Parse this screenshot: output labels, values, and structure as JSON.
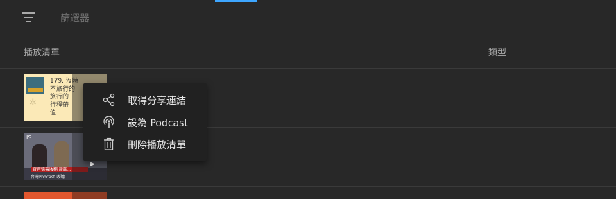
{
  "filter": {
    "icon": "filter-icon",
    "label": "篩選器"
  },
  "table": {
    "headers": {
      "playlist": "播放清單",
      "type": "類型"
    },
    "rows": [
      {
        "thumbnail_text": "179. 沒時\n不旅行的\n旅行的\n行程帶\n值"
      },
      {
        "logo": "IS",
        "banner": "齊吉德雲服務 談談...",
        "subtitle": "台灣Podcast 收聽..."
      },
      {}
    ]
  },
  "menu": {
    "items": [
      {
        "label": "取得分享連結",
        "icon": "share-icon"
      },
      {
        "label": "設為 Podcast",
        "icon": "podcast-icon"
      },
      {
        "label": "刪除播放清單",
        "icon": "trash-icon"
      }
    ]
  },
  "colors": {
    "background": "#282828",
    "menu": "#212121",
    "accent": "#3ea6ff"
  }
}
